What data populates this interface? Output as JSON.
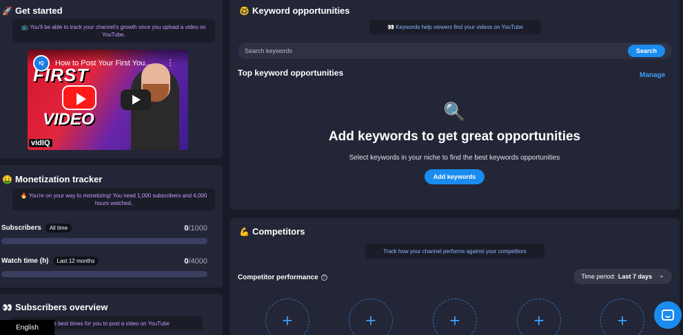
{
  "get_started": {
    "emoji": "🚀",
    "title": "Get started",
    "notice_icon": "📺",
    "notice": "You'll be able to track your channel's growth once you upload a video on YouTube.",
    "video": {
      "title": "How to Post Your First You...",
      "channel_badge": "IQ",
      "thumb_line1": "FIRST",
      "thumb_line2": "VIDEO",
      "logo": "vidIQ",
      "kebab": "⋮"
    }
  },
  "monetization": {
    "emoji": "🤑",
    "title": "Monetization tracker",
    "notice_icon": "🔥",
    "notice": "You're on your way to monetizing! You need 1,000 subscribers and 4,000 hours watched.",
    "subscribers": {
      "label": "Subscribers",
      "pill": "All time",
      "current": "0",
      "target": "/1000",
      "progress": 0
    },
    "watch_time": {
      "label": "Watch time (h)",
      "pill": "Last 12 months",
      "current": "0",
      "target": "/4000",
      "progress": 0
    }
  },
  "subscribers_overview": {
    "emoji": "👀",
    "title": "Subscribers overview",
    "notice": "r the best times for you to post a video on YouTube"
  },
  "keywords": {
    "emoji": "🤓",
    "title": "Keyword opportunities",
    "notice_icon": "👀",
    "notice": "Keywords help viewers find your videos on YouTube",
    "search_placeholder": "Search keywords",
    "search_button": "Search",
    "top_title": "Top keyword opportunities",
    "manage": "Manage",
    "empty_icon": "🔍",
    "empty_title": "Add keywords to get great opportunities",
    "empty_sub": "Select keywords in your niche to find the best keywords opportunities",
    "add_button": "Add keywords"
  },
  "competitors": {
    "emoji": "💪",
    "title": "Competitors",
    "notice": "Track how your channel performs against your competitors",
    "performance_label": "Competitor performance",
    "help": "?",
    "time_period_label": "Time period:",
    "time_period_value": "Last 7 days",
    "chevron": "⌄",
    "slots": [
      "+",
      "+",
      "+",
      "+",
      "+"
    ]
  },
  "footer": {
    "language": "English"
  },
  "colors": {
    "background": "#181a26",
    "card": "#232636",
    "accent": "#1a8cf0",
    "notice_text": "#c79cff"
  }
}
